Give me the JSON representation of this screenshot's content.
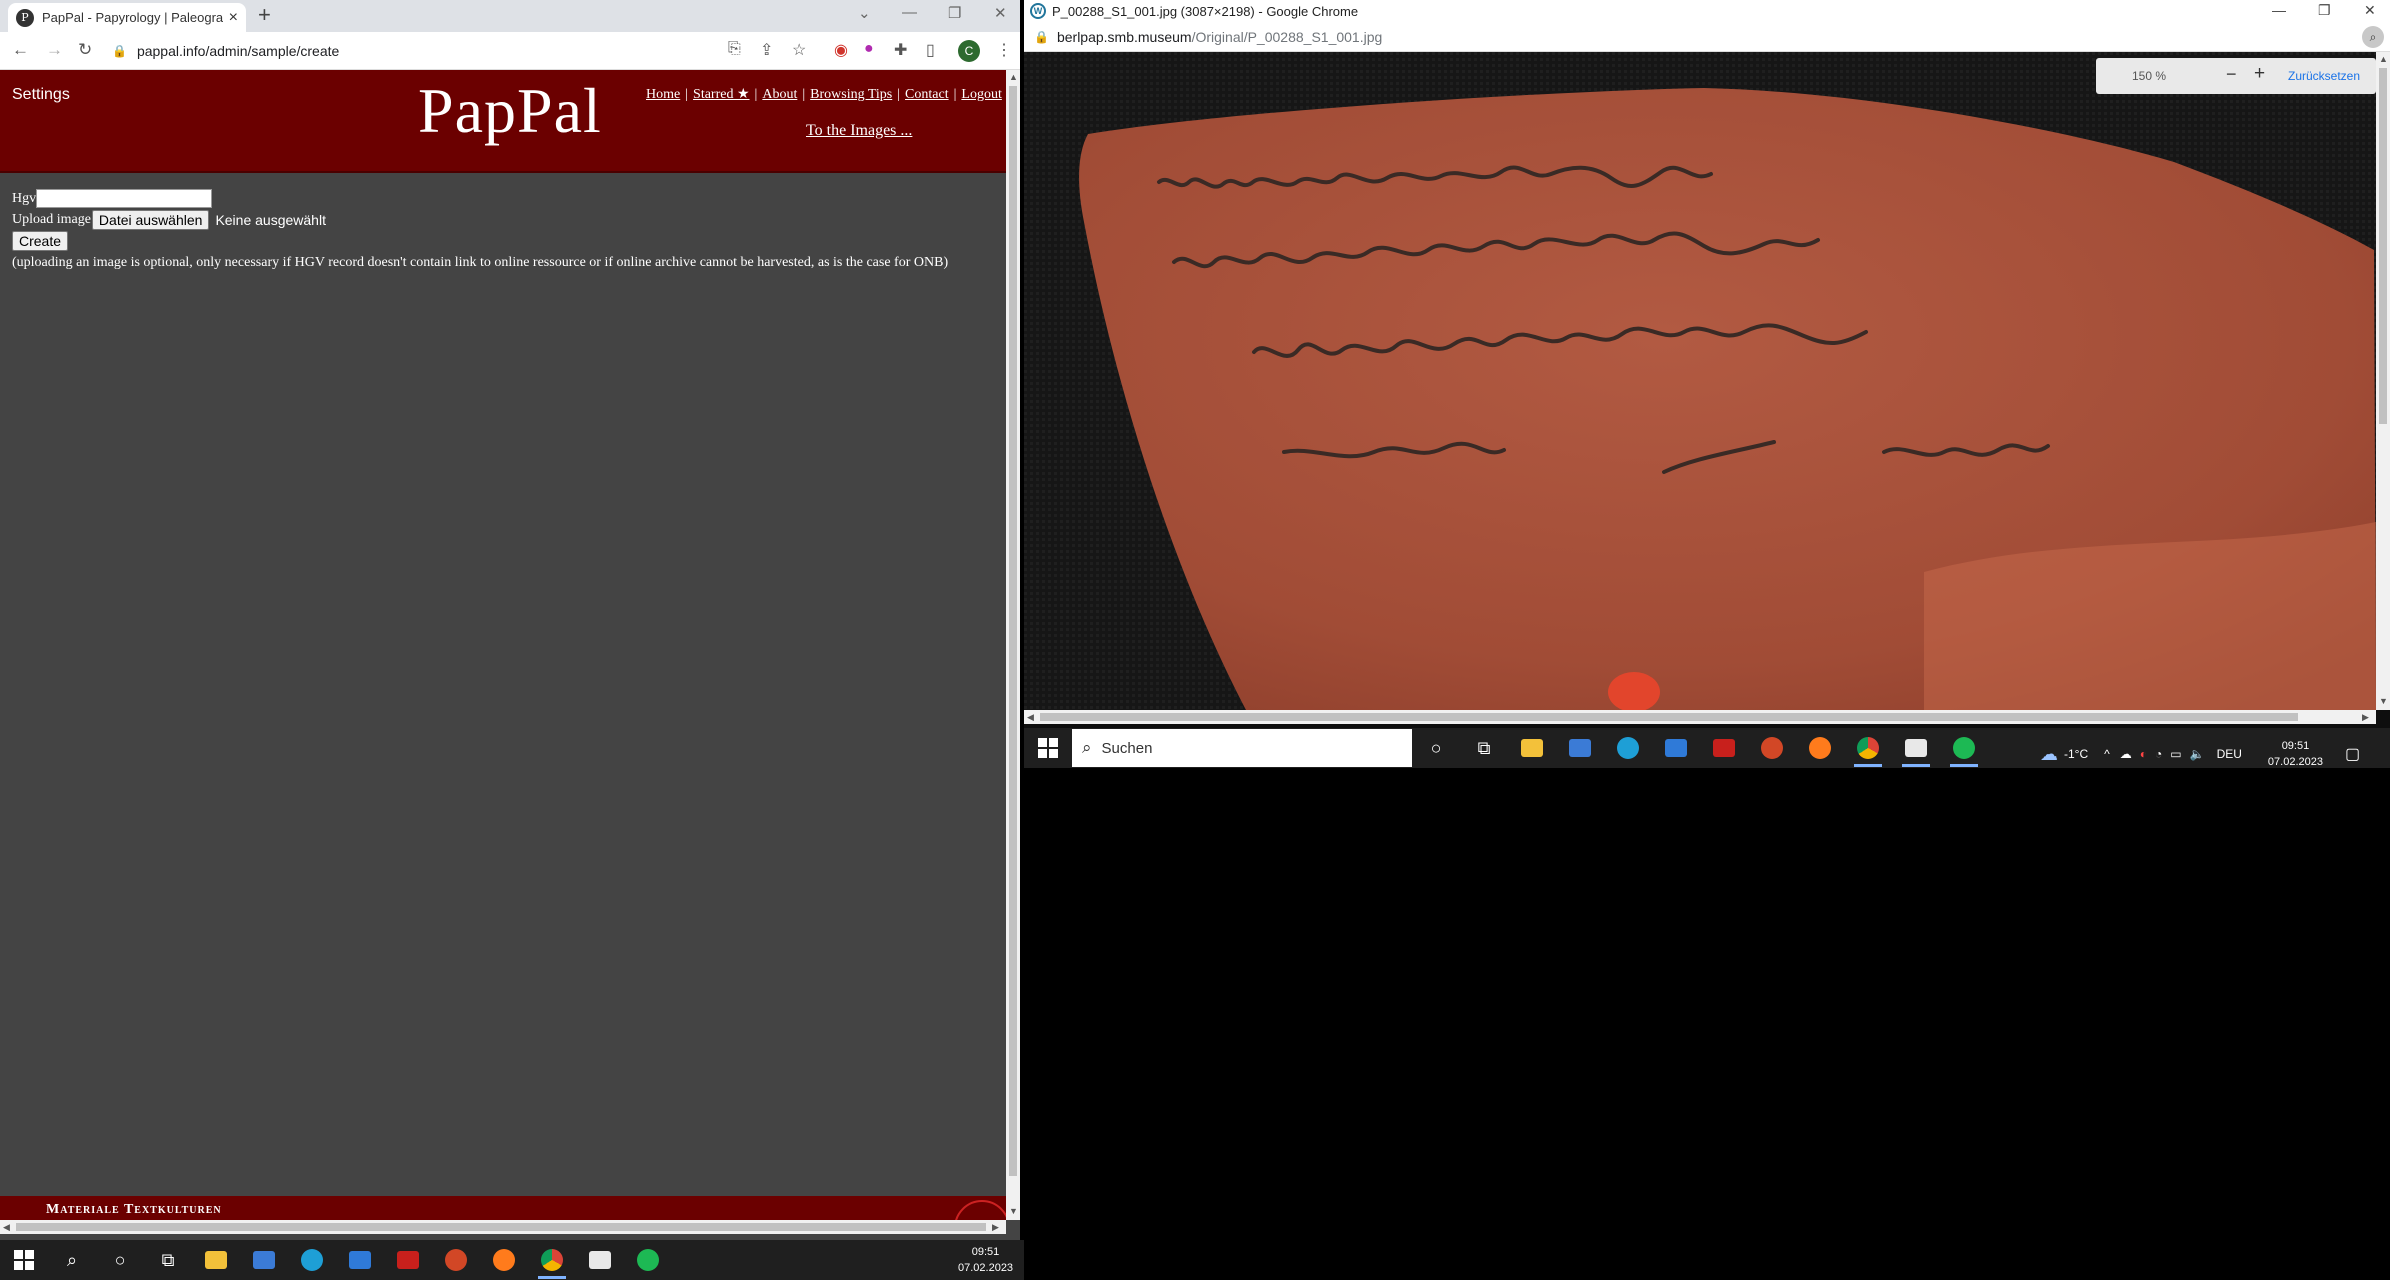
{
  "left_browser": {
    "tab_favicon_letter": "P",
    "tab_title": "PapPal - Papyrology | Paleograph",
    "url": "pappal.info/admin/sample/create"
  },
  "site": {
    "settings": "Settings",
    "logo": "PapPal",
    "nav": [
      "Home",
      "Starred ★",
      "About",
      "Browsing Tips",
      "Contact",
      "Logout"
    ],
    "to_images": "To the Images ...",
    "form": {
      "hgv_label": "Hgv",
      "hgv_value": "",
      "upload_label": "Upload image",
      "file_button": "Datei auswählen",
      "file_status": "Keine ausgewählt",
      "create_button": "Create",
      "note": "(uploading an image is optional, only necessary if HGV record doesn't contain link to online ressource or if online archive cannot be harvested, as is the case for ONB)"
    },
    "footer_title": "Materiale Textkulturen"
  },
  "right_browser": {
    "window_title": "P_00288_S1_001.jpg (3087×2198) - Google Chrome",
    "url_host": "berlpap.smb.museum",
    "url_path": "/Original/P_00288_S1_001.jpg",
    "zoom_level": "150 %",
    "zoom_minus": "−",
    "zoom_plus": "+",
    "zoom_reset": "Zurücksetzen"
  },
  "taskbar_right": {
    "search_placeholder": "Suchen",
    "weather": "-1°C",
    "language": "DEU",
    "time": "09:51",
    "date": "07.02.2023"
  },
  "taskbar_left": {
    "time": "09:51",
    "date": "07.02.2023"
  },
  "colors": {
    "site_header": "#6b0000",
    "page_bg": "#444444",
    "sherd": "#a6503a",
    "ink": "#3a2a25"
  }
}
